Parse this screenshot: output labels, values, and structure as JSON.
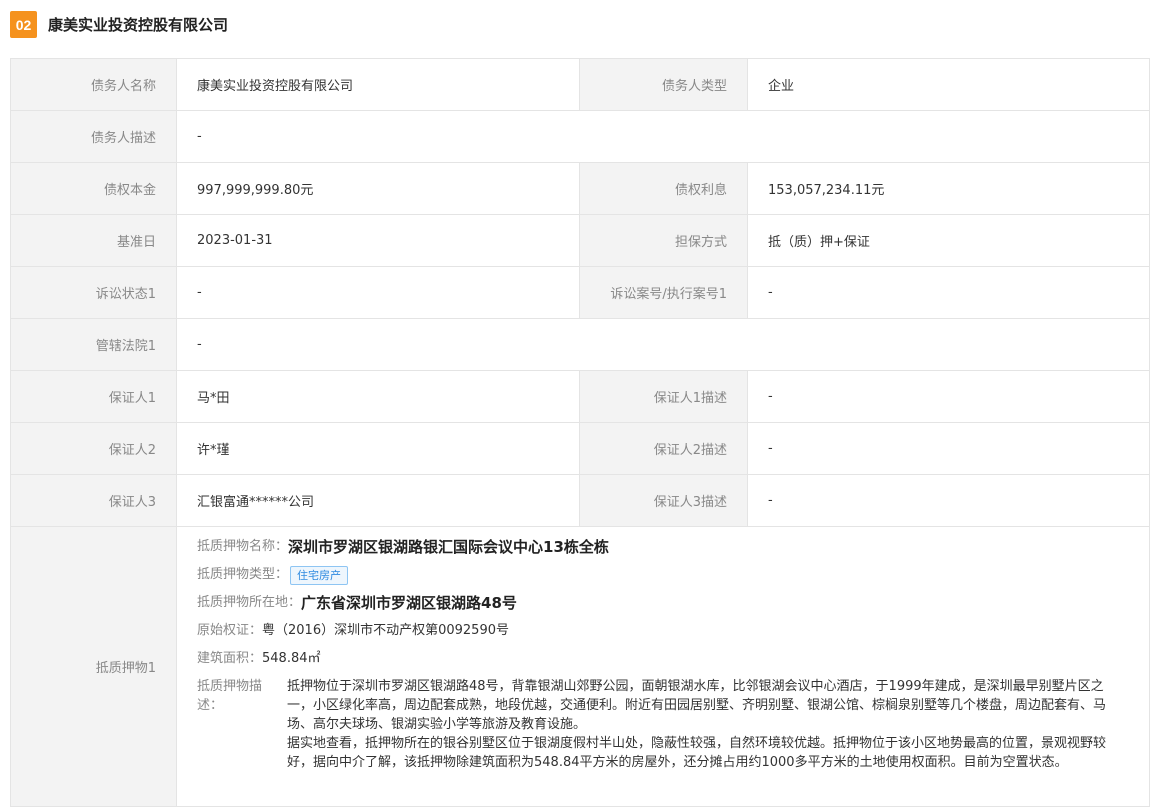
{
  "header": {
    "index": "02",
    "title": "康美实业投资控股有限公司"
  },
  "rows": [
    {
      "label1": "债务人名称",
      "value1": "康美实业投资控股有限公司",
      "label2": "债务人类型",
      "value2": "企业"
    },
    {
      "label1": "债务人描述",
      "value1": "-"
    },
    {
      "label1": "债权本金",
      "value1": "997,999,999.80元",
      "label2": "债权利息",
      "value2": "153,057,234.11元"
    },
    {
      "label1": "基准日",
      "value1": "2023-01-31",
      "label2": "担保方式",
      "value2": "抵（质）押+保证"
    },
    {
      "label1": "诉讼状态1",
      "value1": "-",
      "label2": "诉讼案号/执行案号1",
      "value2": "-"
    },
    {
      "label1": "管辖法院1",
      "value1": "-"
    },
    {
      "label1": "保证人1",
      "value1": "马*田",
      "label2": "保证人1描述",
      "value2": "-"
    },
    {
      "label1": "保证人2",
      "value1": "许*瑾",
      "label2": "保证人2描述",
      "value2": "-"
    },
    {
      "label1": "保证人3",
      "value1": "汇银富通******公司",
      "label2": "保证人3描述",
      "value2": "-"
    }
  ],
  "collateral": {
    "label": "抵质押物1",
    "name_key": "抵质押物名称：",
    "name": "深圳市罗湖区银湖路银汇国际会议中心13栋全栋",
    "type_key": "抵质押物类型：",
    "type_tag": "住宅房产",
    "location_key": "抵质押物所在地：",
    "location": "广东省深圳市罗湖区银湖路48号",
    "cert_key": "原始权证：",
    "cert": "粤（2016）深圳市不动产权第0092590号",
    "area_key": "建筑面积：",
    "area": "548.84㎡",
    "desc_key": "抵质押物描述：",
    "desc_p1": "抵押物位于深圳市罗湖区银湖路48号，背靠银湖山郊野公园，面朝银湖水库，比邻银湖会议中心酒店，于1999年建成，是深圳最早别墅片区之一，小区绿化率高，周边配套成熟，地段优越，交通便利。附近有田园居别墅、齐明别墅、银湖公馆、棕榈泉别墅等几个楼盘，周边配套有、马场、高尔夫球场、银湖实验小学等旅游及教育设施。",
    "desc_p2": "据实地查看，抵押物所在的银谷别墅区位于银湖度假村半山处，隐蔽性较强，自然环境较优越。抵押物位于该小区地势最高的位置，景观视野较好，据向中介了解，该抵押物除建筑面积为548.84平方米的房屋外，还分摊占用约1000多平方米的土地使用权面积。目前为空置状态。"
  }
}
